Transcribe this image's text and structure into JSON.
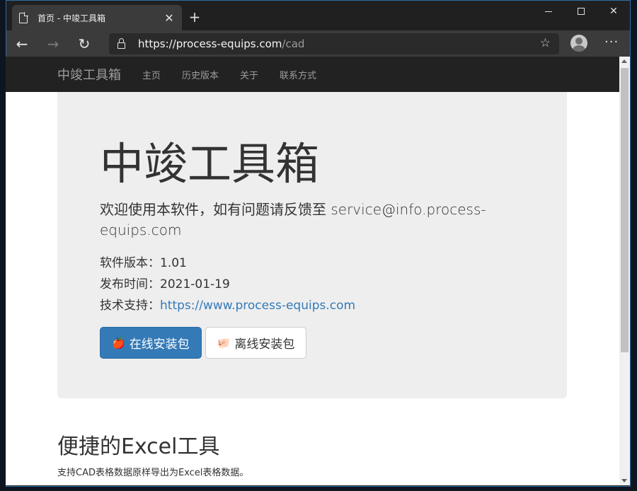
{
  "browser": {
    "tab_title": "首页 - 中竣工具箱",
    "url_main": "https://process-equips.com",
    "url_path": "/cad"
  },
  "site": {
    "brand": "中竣工具箱",
    "nav": [
      "主页",
      "历史版本",
      "关于",
      "联系方式"
    ]
  },
  "hero": {
    "title": "中竣工具箱",
    "lead": "欢迎使用本软件，如有问题请反馈至 service@info.process-equips.com",
    "version_label": "软件版本：",
    "version": "1.01",
    "date_label": "发布时间：",
    "date": "2021-01-19",
    "support_label": "技术支持：",
    "support_link": "https://www.process-equips.com",
    "online_button": "在线安装包",
    "offline_button": "离线安装包"
  },
  "section": {
    "title": "便捷的Excel工具",
    "text": "支持CAD表格数据原样导出为Excel表格数据。"
  }
}
